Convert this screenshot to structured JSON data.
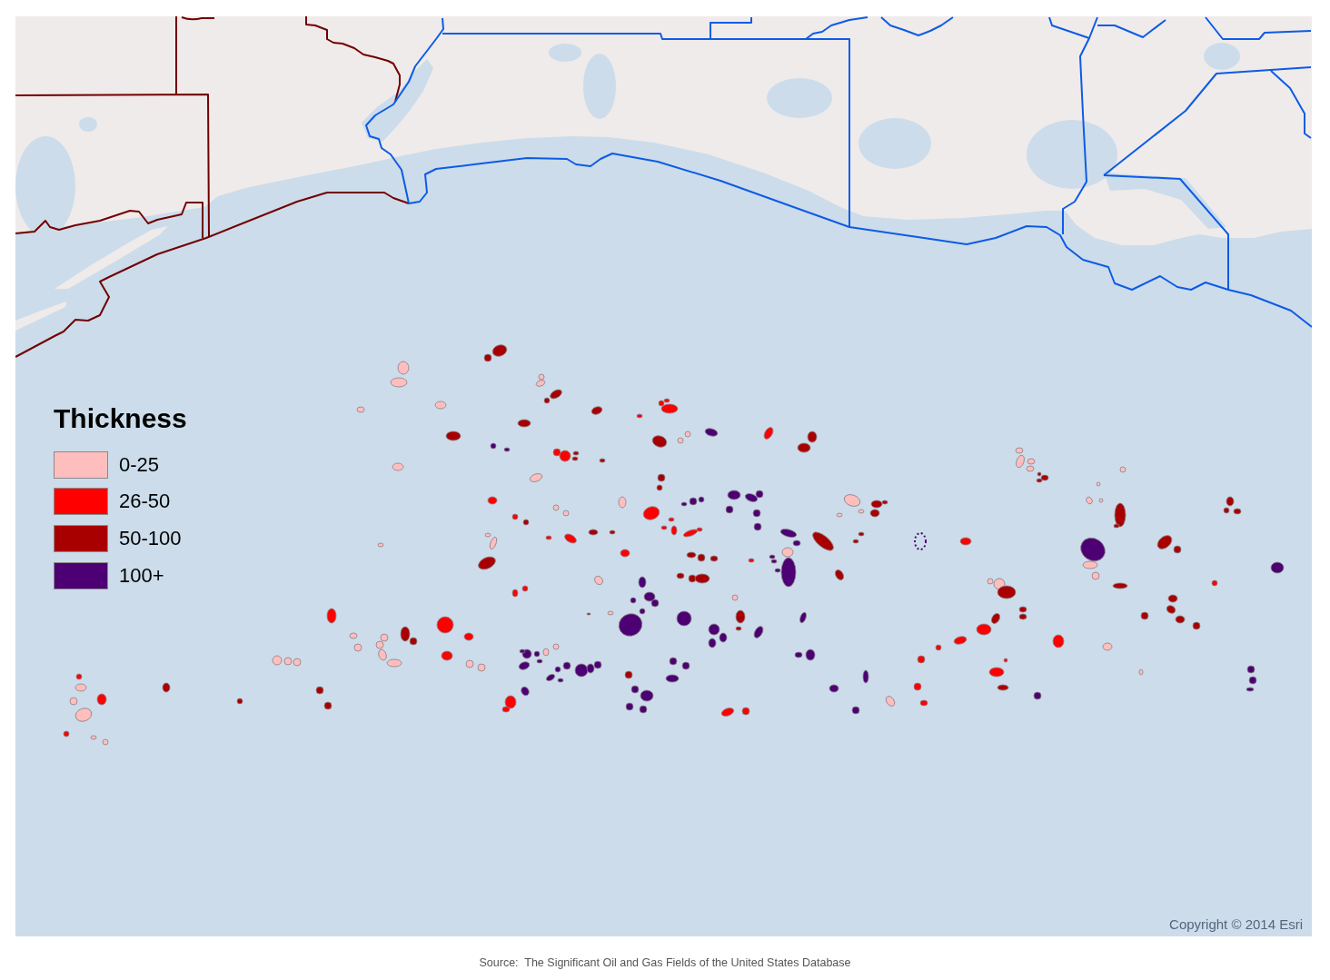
{
  "map": {
    "legend": {
      "title": "Thickness",
      "items": [
        {
          "label": "0-25",
          "color": "#ffbebe"
        },
        {
          "label": "26-50",
          "color": "#ff0000"
        },
        {
          "label": "50-100",
          "color": "#a80000"
        },
        {
          "label": "100+",
          "color": "#4c0073"
        }
      ]
    },
    "copyright": "Copyright © 2014 Esri"
  },
  "caption": "Source:  The Significant Oil and Gas Fields of the United States Database"
}
